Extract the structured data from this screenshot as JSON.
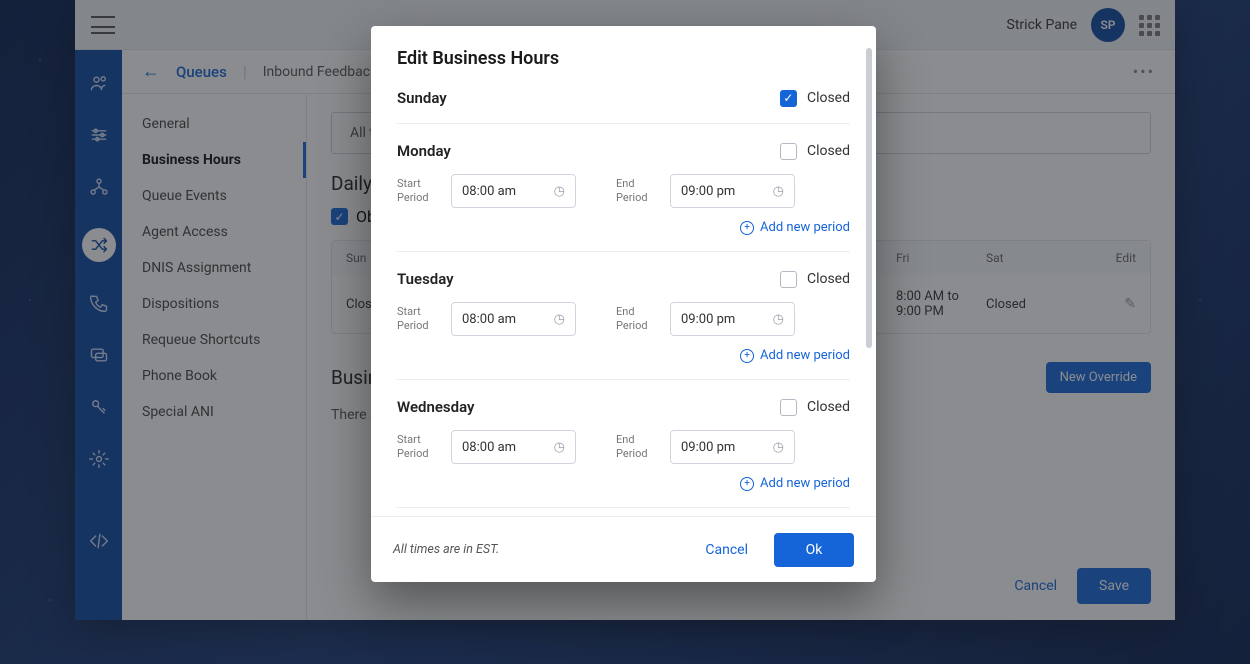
{
  "header": {
    "user_name": "Strick Pane",
    "avatar_initials": "SP"
  },
  "breadcrumbs": {
    "root": "Queues",
    "leaf": "Inbound Feedback Calls"
  },
  "subnav": {
    "items": [
      {
        "label": "General"
      },
      {
        "label": "Business Hours"
      },
      {
        "label": "Queue Events"
      },
      {
        "label": "Agent Access"
      },
      {
        "label": "DNIS Assignment"
      },
      {
        "label": "Dispositions"
      },
      {
        "label": "Requeue Shortcuts"
      },
      {
        "label": "Phone Book"
      },
      {
        "label": "Special ANI"
      }
    ],
    "active_index": 1
  },
  "main": {
    "alltime_label": "All ti",
    "daily_heading": "Daily B",
    "observe_label": "Obs",
    "table": {
      "headers": {
        "sun": "Sun",
        "fri": "Fri",
        "sat": "Sat",
        "edit": "Edit"
      },
      "row": {
        "sun": "Closed",
        "fri": "8:00 AM to 9:00 PM",
        "sat": "Closed"
      }
    },
    "override_heading": "Busine",
    "no_override_text": "There ar",
    "new_override_label": "New Override",
    "footer": {
      "cancel": "Cancel",
      "save": "Save"
    }
  },
  "modal": {
    "title": "Edit Business Hours",
    "closed_label": "Closed",
    "start_label": "Start Period",
    "end_label": "End Period",
    "add_period_label": "Add new period",
    "days": [
      {
        "name": "Sunday",
        "closed": true
      },
      {
        "name": "Monday",
        "closed": false,
        "start": "08:00 am",
        "end": "09:00 pm"
      },
      {
        "name": "Tuesday",
        "closed": false,
        "start": "08:00 am",
        "end": "09:00 pm"
      },
      {
        "name": "Wednesday",
        "closed": false,
        "start": "08:00 am",
        "end": "09:00 pm"
      }
    ],
    "tz_note": "All times are in EST.",
    "cancel_label": "Cancel",
    "ok_label": "Ok"
  }
}
